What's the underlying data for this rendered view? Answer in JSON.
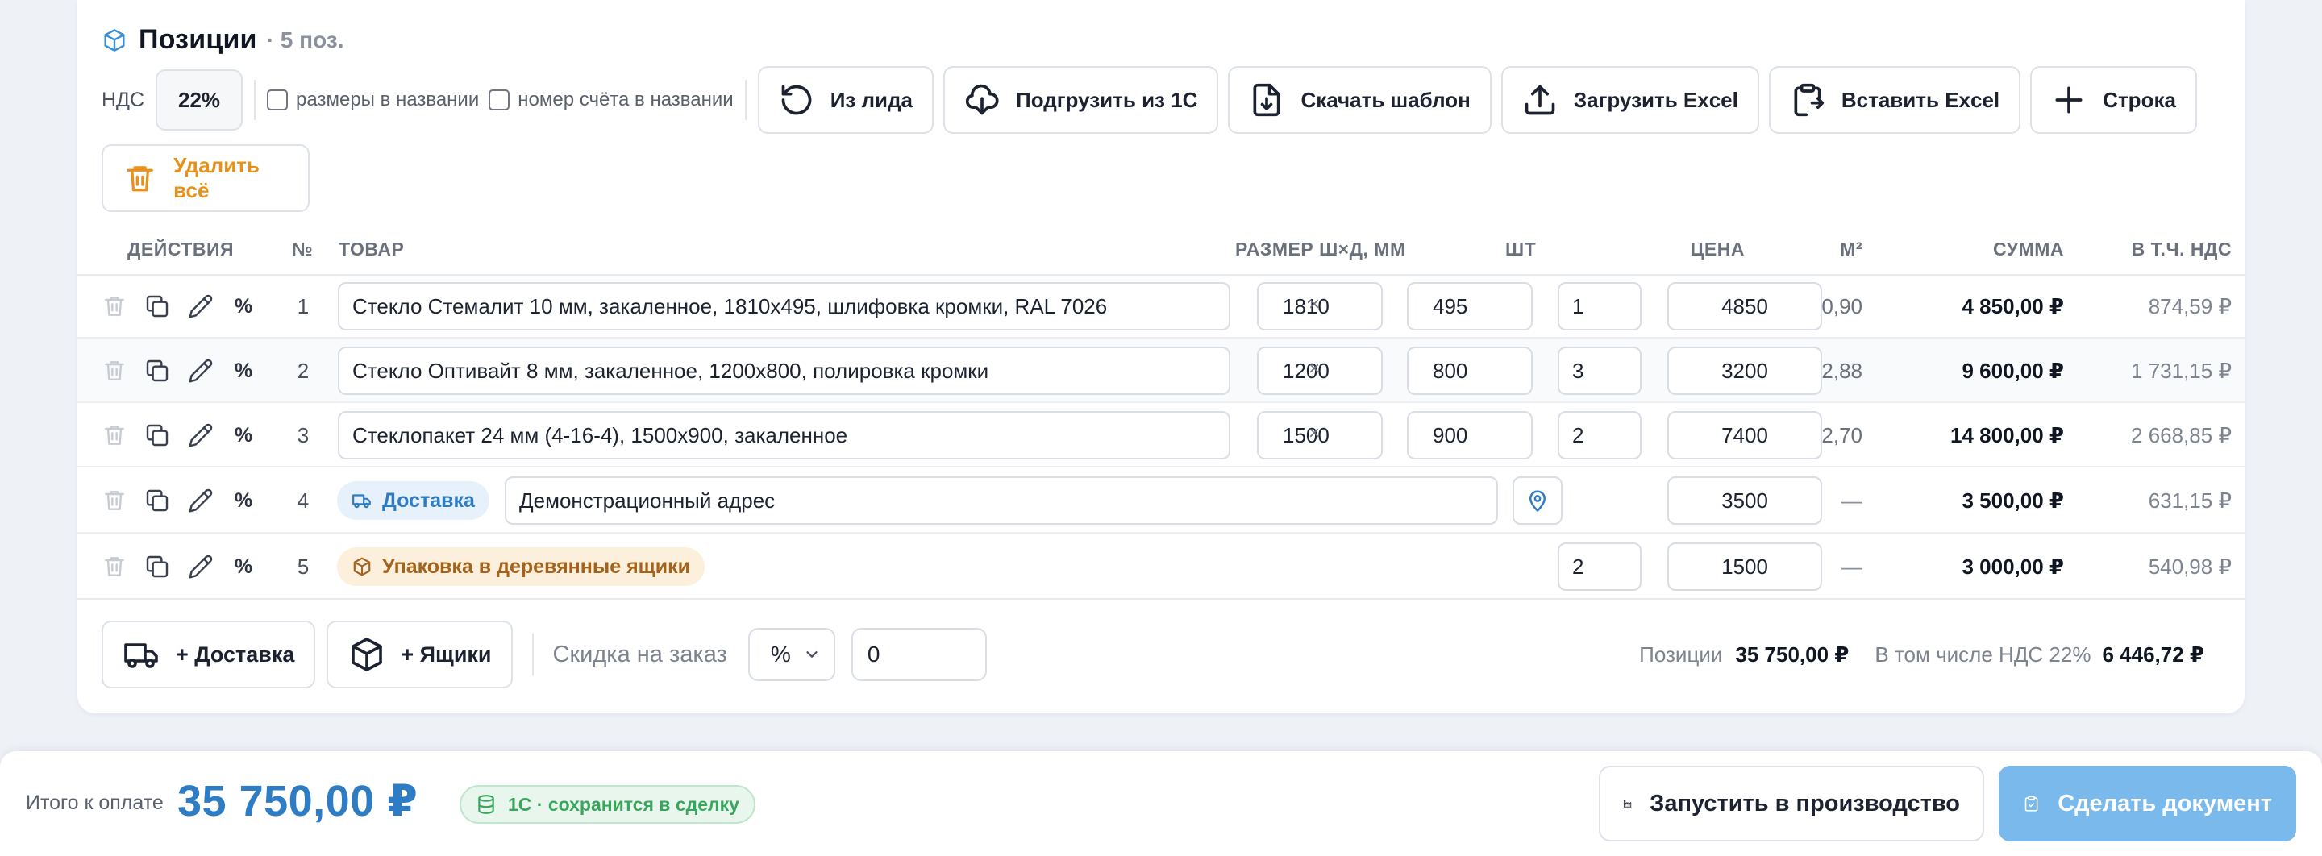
{
  "positions": {
    "title": "Позиции",
    "count": "· 5 поз."
  },
  "toolbar": {
    "vat_label": "НДС",
    "vat_value": "22%",
    "chk_sizes_label": "размеры в названии",
    "chk_invoice_label": "номер счёта в названии",
    "from_lead_label": "Из лида",
    "load_1c_label": "Подгрузить из 1С",
    "download_template_label": "Скачать шаблон",
    "upload_excel_label": "Загрузить Excel",
    "paste_excel_label": "Вставить Excel",
    "add_row_label": "Строка",
    "delete_all_label": "Удалить всё"
  },
  "table": {
    "headers": {
      "actions": "ДЕЙСТВИЯ",
      "no": "№",
      "product": "ТОВАР",
      "size": "РАЗМЕР Ш×Д, ММ",
      "qty": "ШТ",
      "price": "ЦЕНА",
      "m2": "М²",
      "sum": "СУММА",
      "vat": "В Т.Ч. НДС"
    },
    "rows": [
      {
        "no": "1",
        "name": "Стекло Стемалит 10 мм, закаленное, 1810x495, шлифовка кромки, RAL 7026",
        "w": "1810",
        "h": "495",
        "qty": "1",
        "price": "4850",
        "m2": "0,90",
        "sum": "4 850,00 ₽",
        "vat": "874,59 ₽"
      },
      {
        "no": "2",
        "name": "Стекло Оптивайт 8 мм, закаленное, 1200x800, полировка кромки",
        "w": "1200",
        "h": "800",
        "qty": "3",
        "price": "3200",
        "m2": "2,88",
        "sum": "9 600,00 ₽",
        "vat": "1 731,15 ₽"
      },
      {
        "no": "3",
        "name": "Стеклопакет 24 мм (4-16-4), 1500x900, закаленное",
        "w": "1500",
        "h": "900",
        "qty": "2",
        "price": "7400",
        "m2": "2,70",
        "sum": "14 800,00 ₽",
        "vat": "2 668,85 ₽"
      },
      {
        "no": "4",
        "chip": "Доставка",
        "address": "Демонстрационный адрес",
        "price": "3500",
        "m2": "—",
        "sum": "3 500,00 ₽",
        "vat": "631,15 ₽"
      },
      {
        "no": "5",
        "chip": "Упаковка в деревянные ящики",
        "qty": "2",
        "price": "1500",
        "m2": "—",
        "sum": "3 000,00 ₽",
        "vat": "540,98 ₽"
      }
    ],
    "times": "×",
    "pct": "%"
  },
  "footer": {
    "add_delivery_label": "+ Доставка",
    "add_boxes_label": "+ Ящики",
    "discount_label": "Скидка на заказ",
    "discount_type": "%",
    "discount_value": "0",
    "positions_label": "Позиции",
    "positions_total": "35 750,00 ₽",
    "vat_label": "В том числе НДС 22%",
    "vat_total": "6 446,72 ₽"
  },
  "bottom": {
    "pay_label": "Итого к оплате",
    "pay_total": "35 750,00 ₽",
    "sync_label": "1С · сохранится в сделку",
    "production_label": "Запустить в производство",
    "make_doc_label": "Сделать документ"
  },
  "colors": {
    "accent": "#2d7cc4",
    "danger": "#e7911a",
    "success": "#3aa65d",
    "primary_button": "#79b9ec"
  },
  "icons": {
    "row_actions": [
      "trash-icon",
      "copy-icon",
      "pencil-icon"
    ],
    "delivery": "truck-icon",
    "boxes": "box-icon"
  }
}
